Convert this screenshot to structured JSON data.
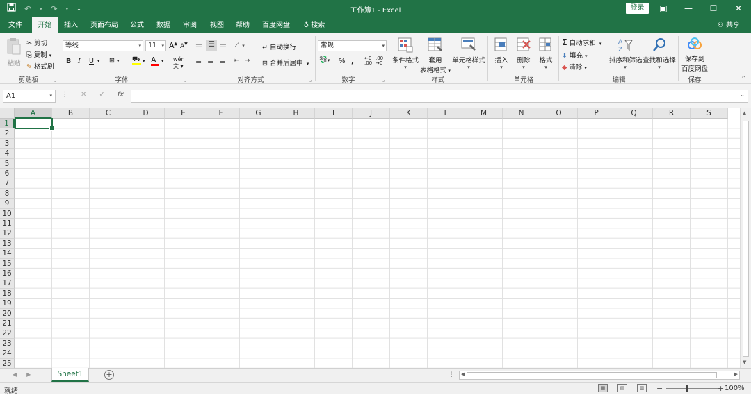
{
  "titlebar": {
    "title": "工作簿1  -  Excel",
    "login": "登录",
    "qat": {
      "save_icon": "save-icon",
      "undo_icon": "undo-icon",
      "redo_icon": "redo-icon",
      "customize_icon": "customize-qat-icon"
    },
    "window": {
      "ribbon_display": "▣",
      "minimize": "—",
      "restore": "☐",
      "close": "✕"
    }
  },
  "tabs": [
    {
      "label": "文件"
    },
    {
      "label": "开始",
      "active": true
    },
    {
      "label": "插入"
    },
    {
      "label": "页面布局"
    },
    {
      "label": "公式"
    },
    {
      "label": "数据"
    },
    {
      "label": "审阅"
    },
    {
      "label": "视图"
    },
    {
      "label": "帮助"
    },
    {
      "label": "百度网盘"
    },
    {
      "label": "搜索"
    }
  ],
  "share": "共享",
  "ribbon": {
    "clipboard": {
      "paste": "粘贴",
      "cut": "剪切",
      "copy": "复制",
      "format_painter": "格式刷",
      "label": "剪贴板"
    },
    "font": {
      "name": "等线",
      "size": "11",
      "grow": "A",
      "shrink": "A",
      "bold": "B",
      "italic": "I",
      "underline": "U",
      "fill_color": "#ffff00",
      "font_color": "#ff0000",
      "label": "字体"
    },
    "alignment": {
      "wrap": "自动换行",
      "merge": "合并后居中",
      "label": "对齐方式"
    },
    "number": {
      "format": "常规",
      "percent": "%",
      "comma": ",",
      "label": "数字"
    },
    "styles": {
      "conditional": "条件格式",
      "table_1": "套用",
      "table_2": "表格格式",
      "cell_styles": "单元格样式",
      "label": "样式"
    },
    "cells": {
      "insert": "插入",
      "delete": "删除",
      "format": "格式",
      "label": "单元格"
    },
    "editing": {
      "autosum": "自动求和",
      "fill": "填充",
      "clear": "清除",
      "sort": "排序和筛选",
      "find": "查找和选择",
      "label": "编辑"
    },
    "save": {
      "line1": "保存到",
      "line2": "百度网盘",
      "label": "保存"
    }
  },
  "formula_bar": {
    "name_box": "A1",
    "cancel": "✕",
    "enter": "✓",
    "fx": "fx",
    "value": ""
  },
  "grid": {
    "columns": [
      "A",
      "B",
      "C",
      "D",
      "E",
      "F",
      "G",
      "H",
      "I",
      "J",
      "K",
      "L",
      "M",
      "N",
      "O",
      "P",
      "Q",
      "R",
      "S"
    ],
    "rows": [
      "1",
      "2",
      "3",
      "4",
      "5",
      "6",
      "7",
      "8",
      "9",
      "10",
      "11",
      "12",
      "13",
      "14",
      "15",
      "16",
      "17",
      "18",
      "19",
      "20",
      "21",
      "22",
      "23",
      "24",
      "25"
    ],
    "active_cell": "A1"
  },
  "sheets": [
    {
      "label": "Sheet1",
      "active": true
    }
  ],
  "status": {
    "ready": "就绪",
    "zoom_out": "−",
    "zoom_in": "+",
    "zoom": "100%"
  }
}
